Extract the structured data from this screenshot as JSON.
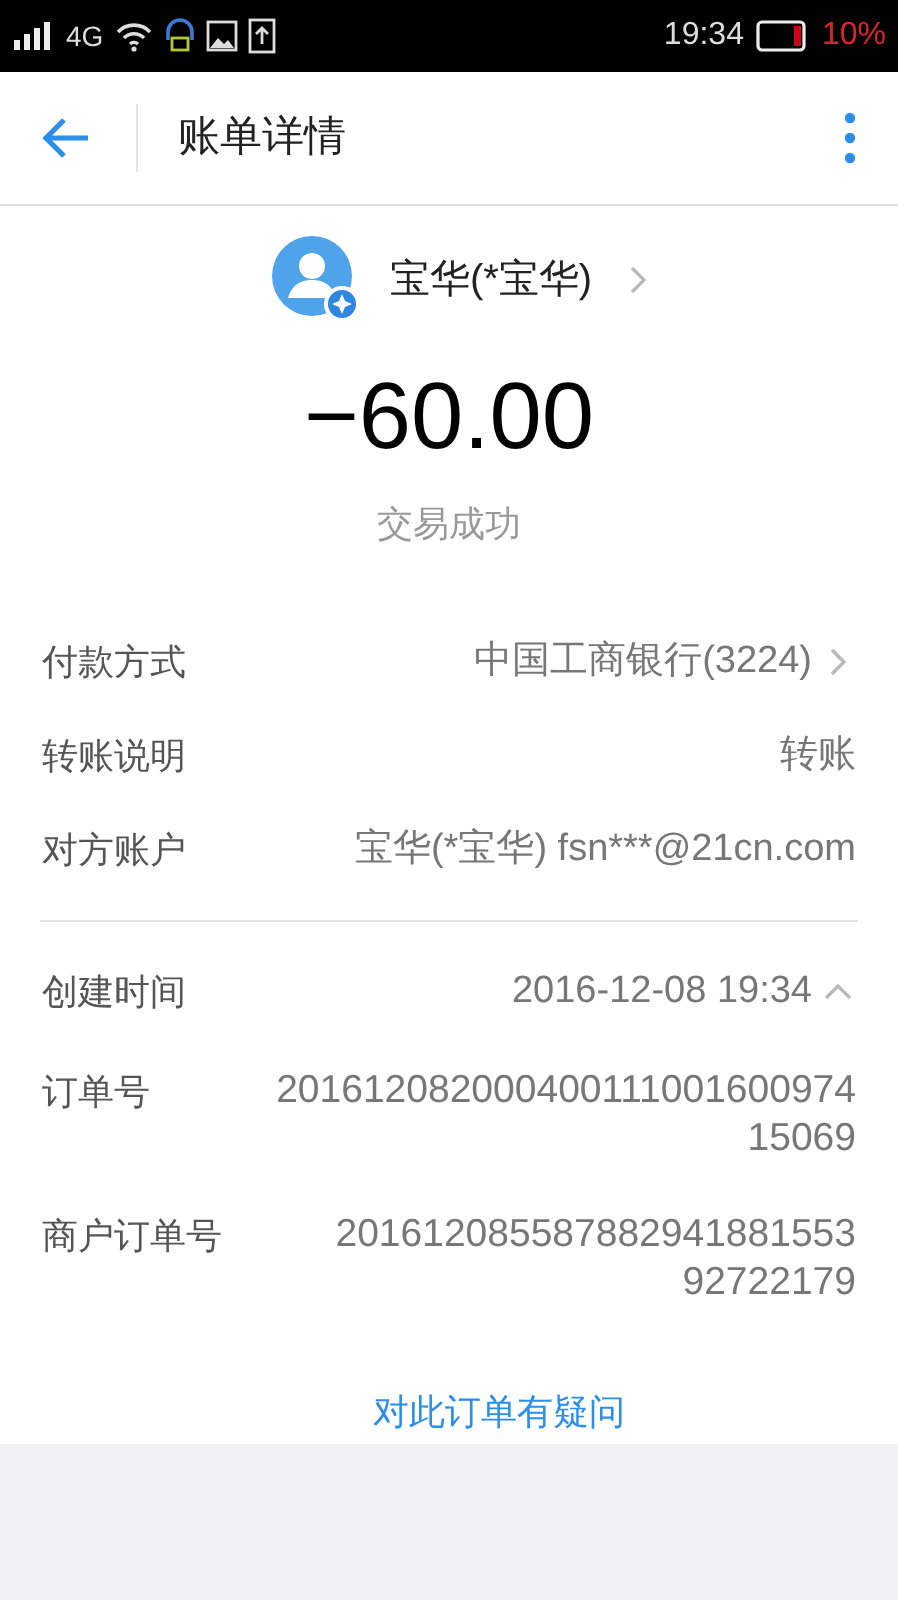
{
  "status_bar": {
    "network": "4G",
    "time": "19:34",
    "battery": "10%"
  },
  "header": {
    "title": "账单详情"
  },
  "payee": {
    "name": "宝华(*宝华)"
  },
  "amount": "−60.00",
  "status": "交易成功",
  "details": [
    {
      "kind": "link",
      "label": "付款方式",
      "value": "中国工商银行(3224)"
    },
    {
      "kind": "plain",
      "label": "转账说明",
      "value": "转账"
    },
    {
      "kind": "plain",
      "label": "对方账户",
      "value": "宝华(*宝华) fsn***@21cn.com"
    }
  ],
  "more": [
    {
      "kind": "toggle",
      "label": "创建时间",
      "value": "2016-12-08 19:34",
      "expanded": true
    },
    {
      "kind": "plain",
      "label": "订单号",
      "value": "201612082000400111001600974 15069"
    },
    {
      "kind": "plain",
      "label": "商户订单号",
      "value": "201612085587882941881553 92722179"
    }
  ],
  "link": "对此订单有疑问"
}
